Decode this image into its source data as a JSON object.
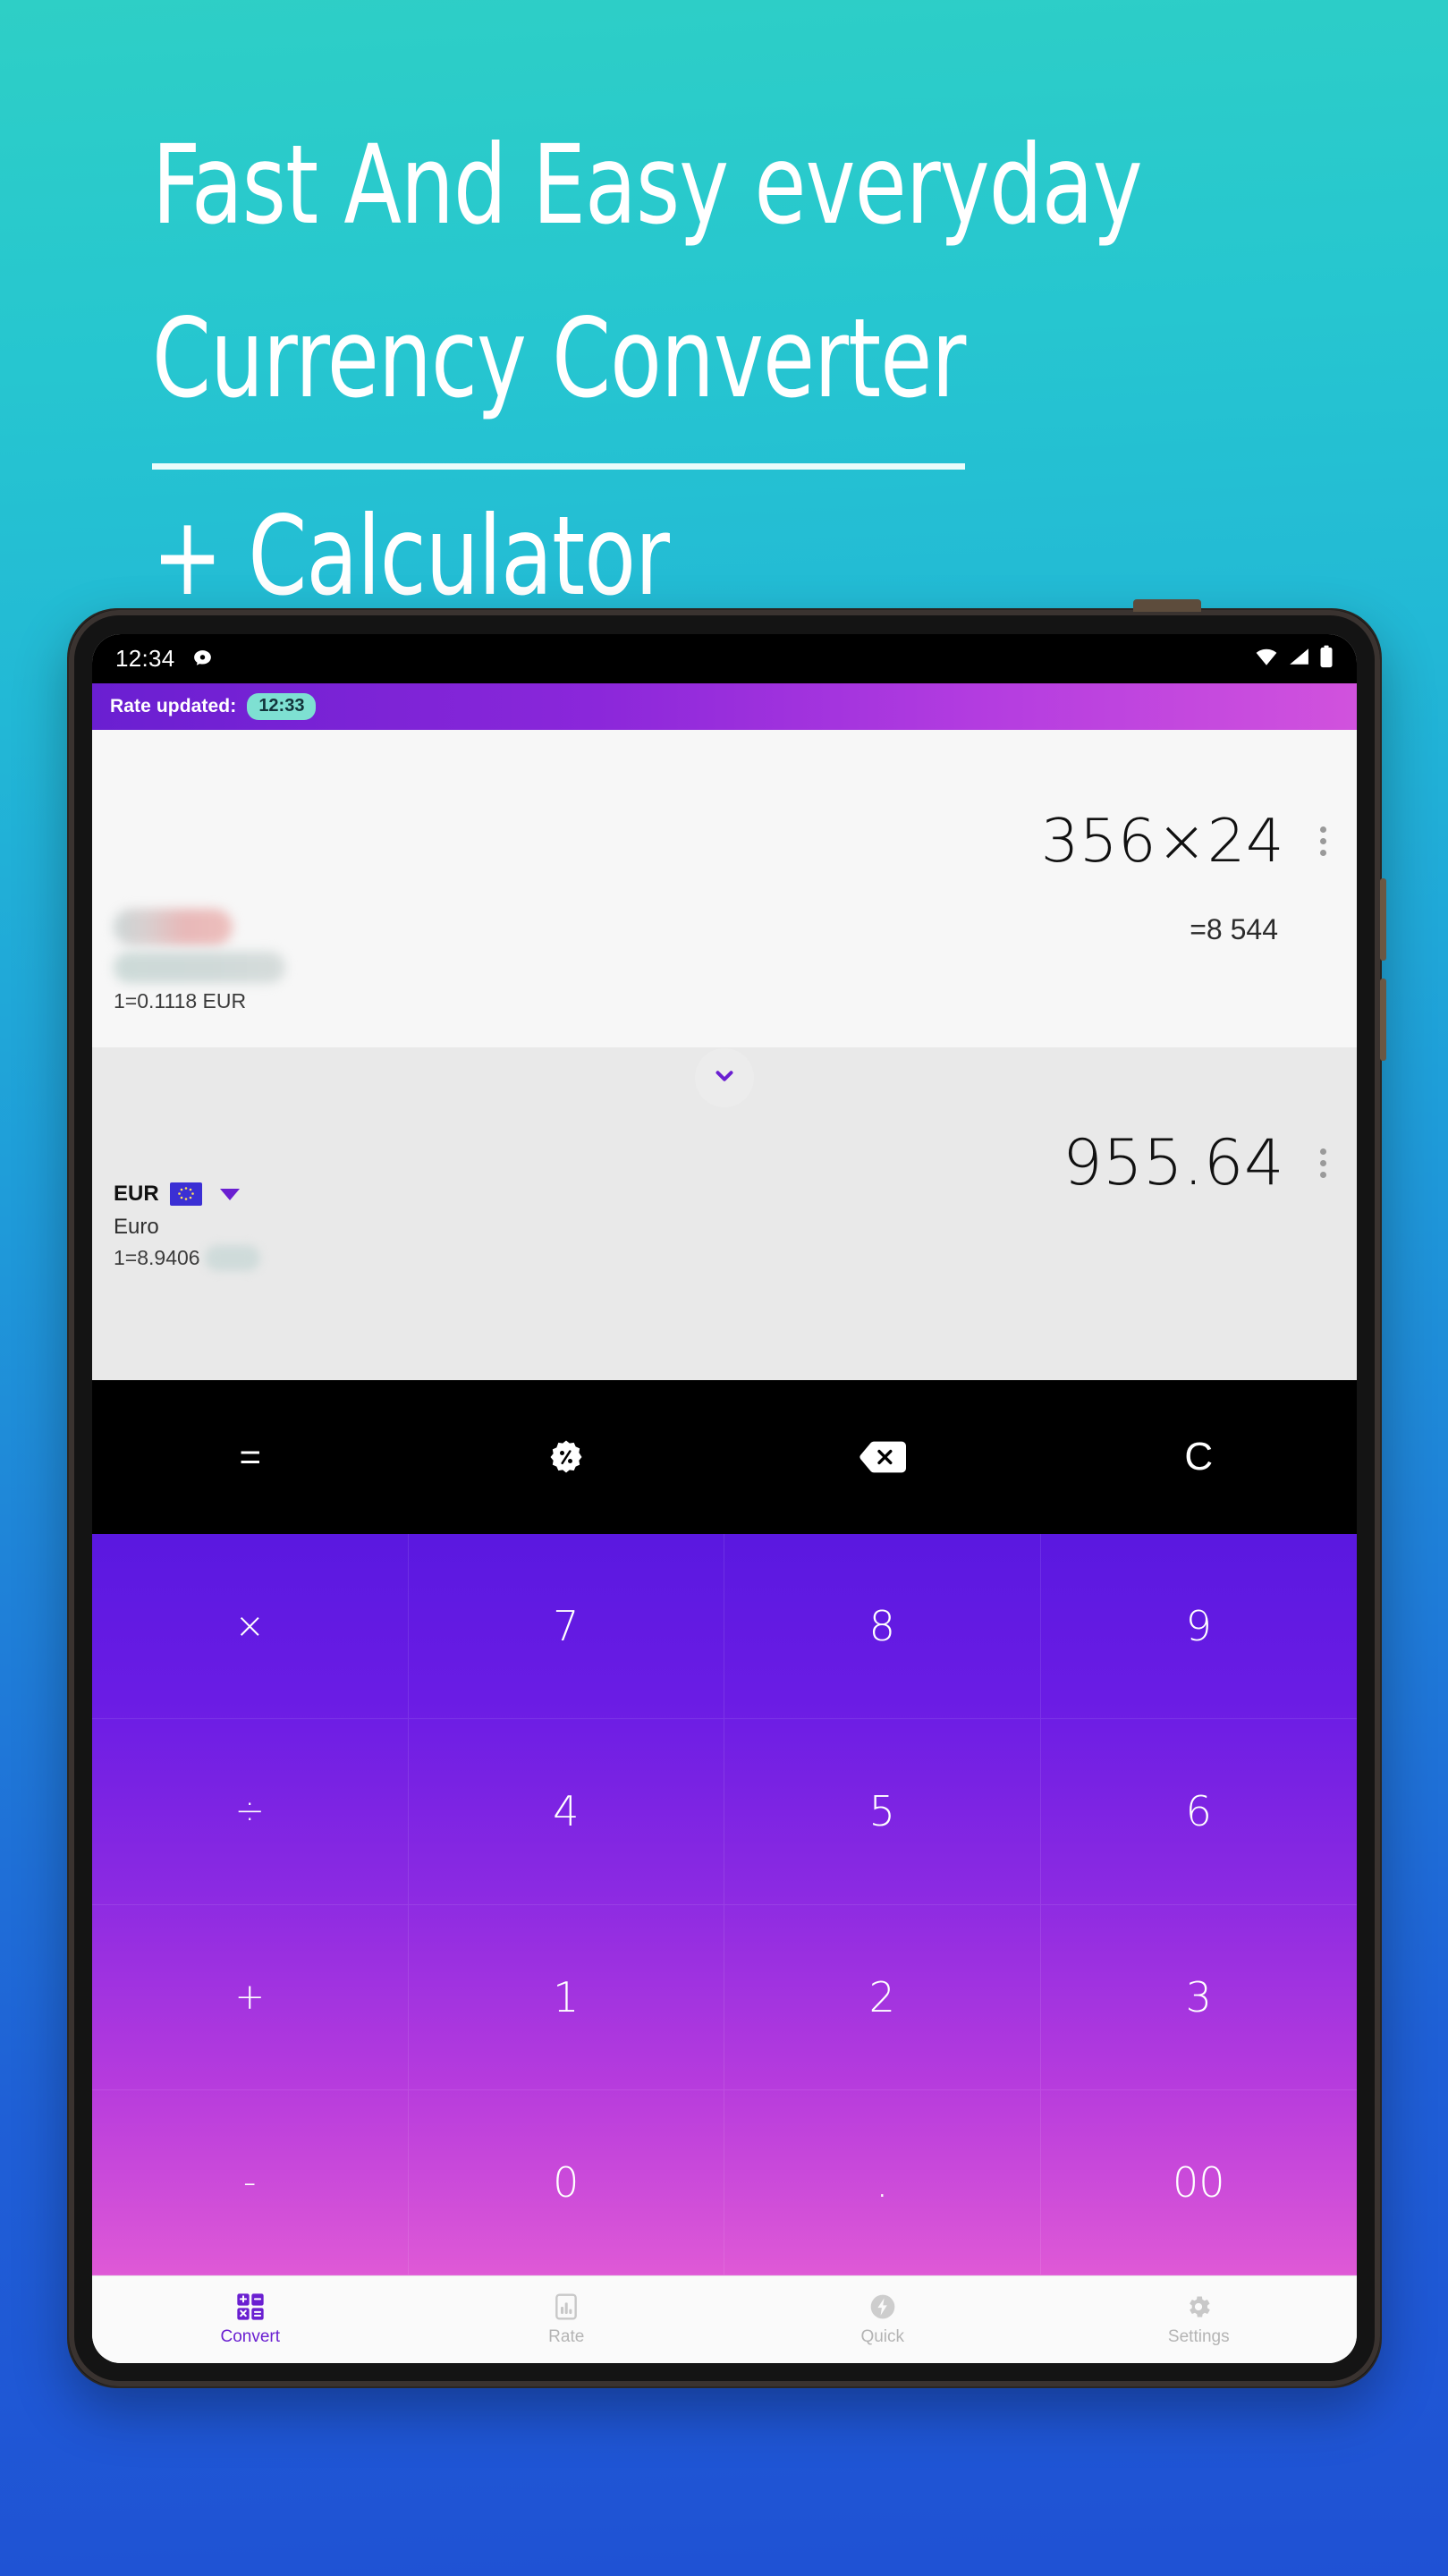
{
  "headline": {
    "line1": "Fast And Easy everyday",
    "line2": "Currency Converter",
    "line3": "+ Calculator"
  },
  "colors": {
    "bg_top": "#2ecfc6",
    "bg_bottom": "#1f51d4",
    "accent_purple": "#6a1fd1",
    "badge_teal": "#7ee0d2",
    "keypad_top": "#5a18e0",
    "keypad_bottom": "#df59d6"
  },
  "statusbar": {
    "time": "12:34",
    "icons": [
      "chat-bubble-icon",
      "wifi-icon",
      "signal-icon",
      "battery-icon"
    ]
  },
  "ratebar": {
    "label": "Rate updated:",
    "time_badge": "12:33"
  },
  "source": {
    "currency_code_redacted": true,
    "currency_name_redacted": true,
    "rate_line": "1=0.1118 EUR",
    "expression": "356×24",
    "result": "=8 544",
    "menu_icon": "kebab-menu-icon"
  },
  "swap": {
    "icon": "chevron-down-icon"
  },
  "target": {
    "code": "EUR",
    "flag": "eu-flag-icon",
    "dropdown_icon": "chevron-down-icon",
    "name": "Euro",
    "rate_prefix": "1=8.9406",
    "rate_currency_redacted": true,
    "amount": "955.64",
    "menu_icon": "kebab-menu-icon"
  },
  "functions": [
    {
      "label": "=",
      "name": "equals-button",
      "icon": ""
    },
    {
      "label": "",
      "name": "percent-button",
      "icon": "percent-badge-icon"
    },
    {
      "label": "",
      "name": "backspace-button",
      "icon": "backspace-icon"
    },
    {
      "label": "C",
      "name": "clear-button",
      "icon": ""
    }
  ],
  "keypad": [
    {
      "label": "×",
      "name": "key-multiply",
      "type": "op"
    },
    {
      "label": "7",
      "name": "key-7",
      "type": "digit"
    },
    {
      "label": "8",
      "name": "key-8",
      "type": "digit"
    },
    {
      "label": "9",
      "name": "key-9",
      "type": "digit"
    },
    {
      "label": "÷",
      "name": "key-divide",
      "type": "op"
    },
    {
      "label": "4",
      "name": "key-4",
      "type": "digit"
    },
    {
      "label": "5",
      "name": "key-5",
      "type": "digit"
    },
    {
      "label": "6",
      "name": "key-6",
      "type": "digit"
    },
    {
      "label": "+",
      "name": "key-plus",
      "type": "op"
    },
    {
      "label": "1",
      "name": "key-1",
      "type": "digit"
    },
    {
      "label": "2",
      "name": "key-2",
      "type": "digit"
    },
    {
      "label": "3",
      "name": "key-3",
      "type": "digit"
    },
    {
      "label": "-",
      "name": "key-minus",
      "type": "op"
    },
    {
      "label": "0",
      "name": "key-0",
      "type": "digit"
    },
    {
      "label": ".",
      "name": "key-decimal",
      "type": "digit"
    },
    {
      "label": "00",
      "name": "key-double-zero",
      "type": "digit"
    }
  ],
  "bottomnav": [
    {
      "label": "Convert",
      "icon": "calculator-grid-icon",
      "active": true
    },
    {
      "label": "Rate",
      "icon": "chart-bar-icon",
      "active": false
    },
    {
      "label": "Quick",
      "icon": "flash-circle-icon",
      "active": false
    },
    {
      "label": "Settings",
      "icon": "gear-icon",
      "active": false
    }
  ]
}
